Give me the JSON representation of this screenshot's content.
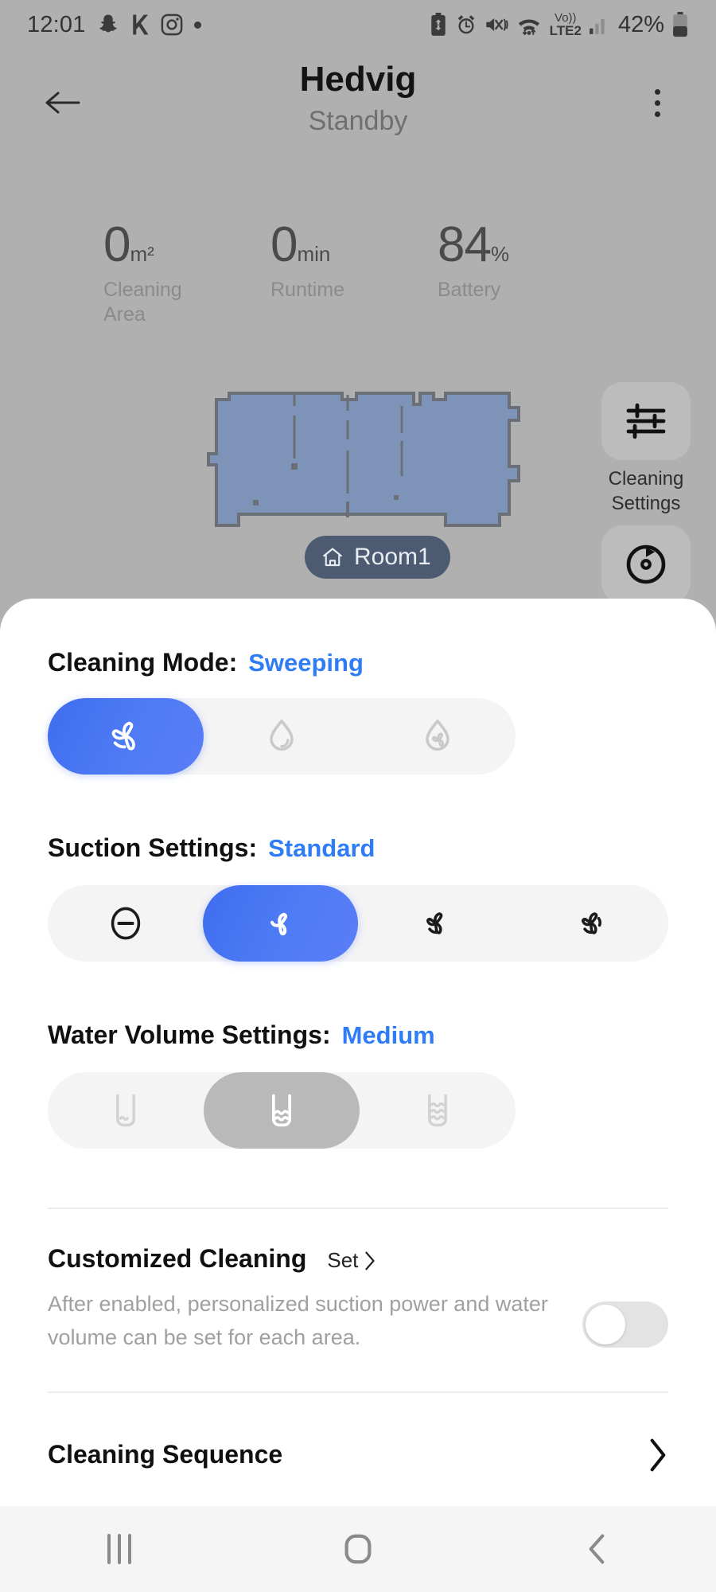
{
  "statusbar": {
    "time": "12:01",
    "network_label": "LTE2",
    "volte_label": "Vo))",
    "battery_percent": "42%",
    "left_icons": [
      "snapchat-icon",
      "k-letter-icon",
      "instagram-icon",
      "dot-icon"
    ],
    "right_icons": [
      "battery-saver-icon",
      "alarm-icon",
      "mute-vibrate-icon",
      "wifi-icon",
      "volte-icon",
      "signal-icon",
      "battery-icon"
    ]
  },
  "header": {
    "back_icon": "back-arrow-icon",
    "title": "Hedvig",
    "status": "Standby",
    "menu_icon": "overflow-menu-icon"
  },
  "stats": [
    {
      "value": "0",
      "unit": "m²",
      "label": "Cleaning Area"
    },
    {
      "value": "0",
      "unit": "min",
      "label": "Runtime"
    },
    {
      "value": "84",
      "unit": "%",
      "label": "Battery"
    }
  ],
  "map": {
    "room_chip_label": "Room1",
    "room_chip_icon": "home-icon",
    "floor_color": "#7e93b8",
    "wall_color": "#6a6f78",
    "background_color": "#b0b0b0"
  },
  "side_buttons": [
    {
      "icon": "sliders-icon",
      "caption": "Cleaning Settings"
    },
    {
      "icon": "refresh-map-icon",
      "caption": ""
    }
  ],
  "sheet": {
    "cleaning_mode": {
      "label": "Cleaning Mode:",
      "value": "Sweeping",
      "options": [
        {
          "icon": "fan-sweep-icon",
          "name": "sweeping",
          "state": "selected"
        },
        {
          "icon": "water-drop-icon",
          "name": "mopping",
          "state": "normal"
        },
        {
          "icon": "water-drop-sweep-icon",
          "name": "sweep-and-mop",
          "state": "normal"
        }
      ]
    },
    "suction_settings": {
      "label": "Suction Settings:",
      "value": "Standard",
      "options": [
        {
          "icon": "minus-circle-icon",
          "name": "quiet",
          "state": "normal"
        },
        {
          "icon": "fan-standard-icon",
          "name": "standard",
          "state": "selected"
        },
        {
          "icon": "fan-medium-icon",
          "name": "medium",
          "state": "normal"
        },
        {
          "icon": "fan-turbo-icon",
          "name": "turbo",
          "state": "normal"
        }
      ]
    },
    "water_volume_settings": {
      "label": "Water Volume Settings:",
      "value": "Medium",
      "options": [
        {
          "icon": "water-low-icon",
          "name": "low",
          "state": "disabled"
        },
        {
          "icon": "water-medium-icon",
          "name": "medium",
          "state": "selected-disabled"
        },
        {
          "icon": "water-high-icon",
          "name": "high",
          "state": "disabled"
        }
      ]
    },
    "customized_cleaning": {
      "title": "Customized Cleaning",
      "set_label": "Set",
      "set_icon": "chevron-right-icon",
      "description": "After enabled, personalized suction power and water volume can be set for each area.",
      "toggle_state": "off"
    },
    "cleaning_sequence": {
      "title": "Cleaning Sequence",
      "chevron_icon": "chevron-right-icon"
    }
  },
  "navbar": {
    "items": [
      {
        "icon": "recents-icon",
        "name": "recents"
      },
      {
        "icon": "home-square-icon",
        "name": "home"
      },
      {
        "icon": "back-chevron-icon",
        "name": "back"
      }
    ]
  },
  "colors": {
    "accent_blue": "#2f7df6",
    "selected_gradient_from": "#3f6dee",
    "selected_gradient_to": "#5a7ef7",
    "disabled_gray": "#b9b9b9",
    "track_gray": "#f4f4f5"
  }
}
